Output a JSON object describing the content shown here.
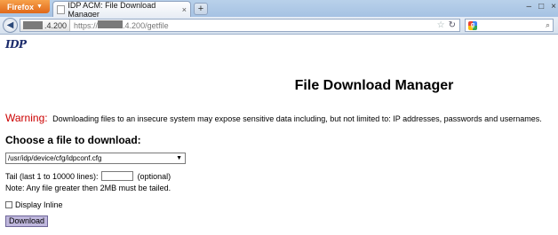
{
  "browser": {
    "menu_button_label": "Firefox",
    "tab_title": "IDP ACM: File Download Manager",
    "new_tab_symbol": "+",
    "url_host_suffix": ".4.200",
    "url_prefix": "https://",
    "url_path": ".4.200/getfile",
    "search_engine_icon": "g-icon"
  },
  "page": {
    "logo_text": "IDP",
    "title": "File Download Manager",
    "warning_label": "Warning:",
    "warning_text": "Downloading files to an insecure system may expose sensitive data including, but not limited to: IP addresses, passwords and usernames.",
    "section_heading": "Choose a file to download:",
    "file_select_value": "/usr/idp/device/cfg/idpconf.cfg",
    "tail_label": "Tail (last 1 to 10000 lines):",
    "tail_value": "",
    "tail_optional": "(optional)",
    "note": "Note: Any file greater then 2MB must be tailed.",
    "display_inline_label": "Display Inline",
    "download_button": "Download"
  }
}
